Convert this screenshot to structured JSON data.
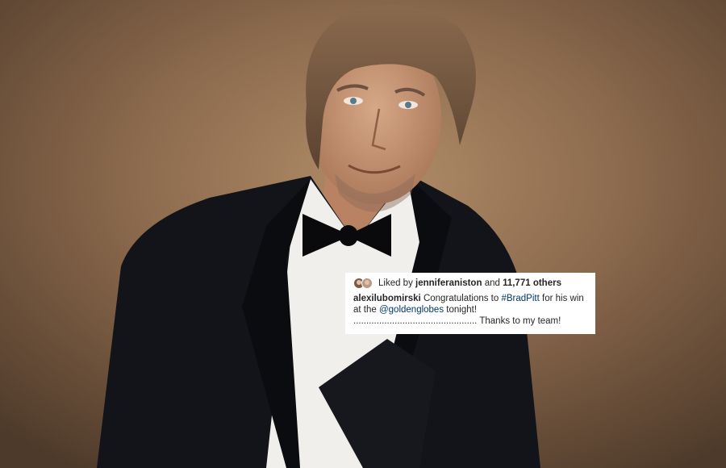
{
  "post": {
    "likes": {
      "prefix": "Liked by",
      "liker": "jenniferaniston",
      "conjunction": "and",
      "others": "11,771 others"
    },
    "caption": {
      "username": "alexilubomirski",
      "text_1": "Congratulations to",
      "hashtag": "#BradPitt",
      "text_2": "for his win at the",
      "mention": "@goldenglobes",
      "text_3": "tonight! ................................................ Thanks to my team!"
    }
  },
  "colors": {
    "background_warm": "#8a6a4c",
    "suit": "#121318",
    "shirt": "#f2f0ec",
    "link": "#00376b",
    "text": "#262626"
  },
  "icons": [
    "liker-avatar-icon",
    "liker-avatar-icon-2"
  ]
}
